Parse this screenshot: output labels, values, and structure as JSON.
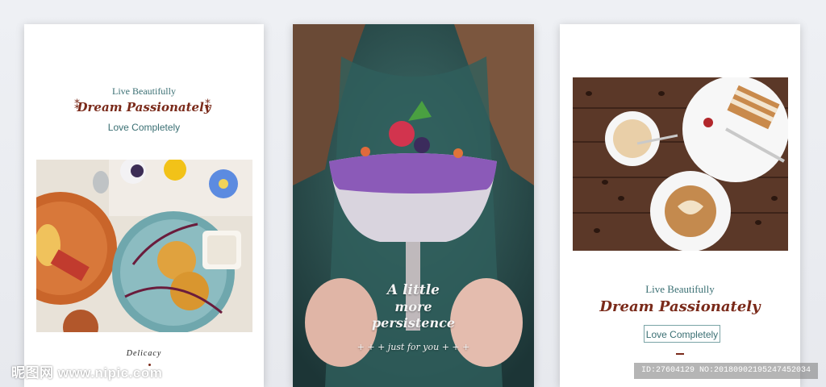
{
  "card1": {
    "live": "Live Beautifully",
    "dream": "Dream Passionately",
    "love": "Love Completely",
    "caption": "Delicacy",
    "photo_desc_icon": "food-plates-photo"
  },
  "card2": {
    "line1": "A little",
    "line2": "more",
    "line3": "persistence",
    "sub": "+ + + just for you + + +",
    "photo_desc_icon": "dessert-cup-photo"
  },
  "card3": {
    "live": "Live Beautifully",
    "dream": "Dream Passionately",
    "love": "Love Completely",
    "photo_desc_icon": "coffee-cake-photo"
  },
  "watermark": {
    "site": "昵图网 www.nipic.com",
    "id": "ID:27604129 NO:20180902195247452034"
  },
  "colors": {
    "accent_brown": "#7a2a1a",
    "accent_teal": "#3a6f73"
  }
}
